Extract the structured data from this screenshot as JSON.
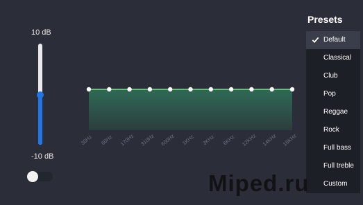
{
  "gain": {
    "max_label": "10 dB",
    "min_label": "-10 dB"
  },
  "level_fraction": 0.49,
  "toggle_on": false,
  "presets": {
    "title": "Presets",
    "items": [
      "Default",
      "Classical",
      "Club",
      "Pop",
      "Reggae",
      "Rock",
      "Full bass",
      "Full treble",
      "Custom"
    ],
    "selected": "Default"
  },
  "chart_data": {
    "type": "area",
    "categories": [
      "30Hz",
      "60Hz",
      "170Hz",
      "310Hz",
      "600Hz",
      "1KHz",
      "3KHz",
      "6KHz",
      "12KHz",
      "14KHz",
      "16KHz"
    ],
    "values": [
      0,
      0,
      0,
      0,
      0,
      0,
      0,
      0,
      0,
      0,
      0
    ],
    "ylim": [
      -10,
      10
    ],
    "line_color": "#7de08a",
    "fill_color": "#2f6a55",
    "point_color": "#ffffff",
    "grid": false
  },
  "watermark": "Miped.ru",
  "colors": {
    "background": "#2b2e38",
    "accent": "#1f76e6"
  }
}
